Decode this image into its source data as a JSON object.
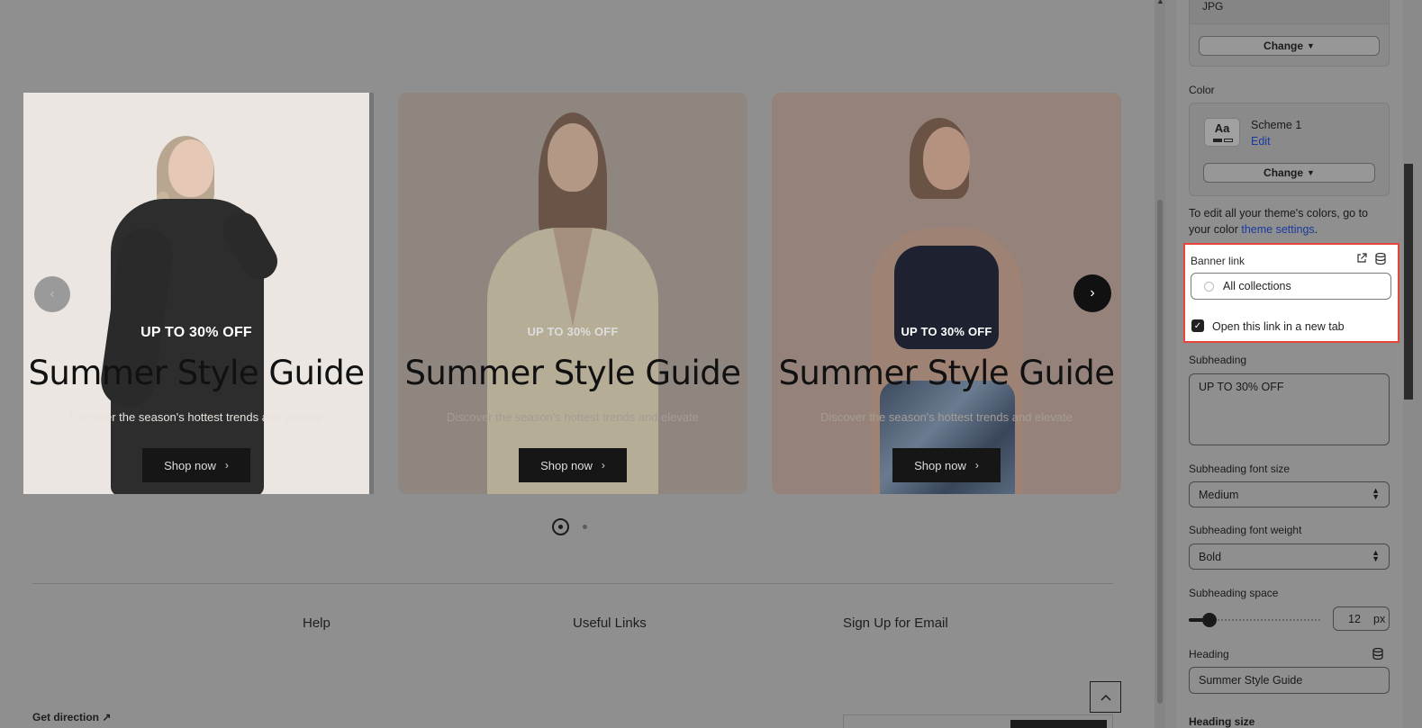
{
  "slides": [
    {
      "subheading": "UP TO 30% OFF",
      "heading": "Summer Style Guide",
      "description": "Discover the season's hottest trends and elevate",
      "button": "Shop now"
    },
    {
      "subheading": "UP TO 30% OFF",
      "heading": "Summer Style Guide",
      "description": "Discover the season's hottest trends and elevate",
      "button": "Shop now"
    },
    {
      "subheading": "UP TO 30% OFF",
      "heading": "Summer Style Guide",
      "description": "Discover the season's hottest trends and elevate",
      "button": "Shop now"
    }
  ],
  "carousel": {
    "prev_icon": "‹",
    "next_icon": "›",
    "active_page": 1,
    "page_count": 2
  },
  "footer": {
    "columns": [
      "Help",
      "Useful Links",
      "Sign Up for Email"
    ],
    "get_direction": "Get direction",
    "back_to_top_icon": "chevron-up-icon"
  },
  "panel": {
    "image_format": "JPG",
    "change_label": "Change",
    "color_label": "Color",
    "scheme": {
      "name": "Scheme 1",
      "edit": "Edit",
      "swatch_text": "Aa"
    },
    "theme_note_prefix": "To edit all your theme's colors, go to your color",
    "theme_note_link": "theme settings",
    "theme_note_suffix": ".",
    "banner_link": {
      "label": "Banner link",
      "value": "All collections",
      "new_tab_label": "Open this link in a new tab",
      "new_tab_checked": true
    },
    "subheading": {
      "label": "Subheading",
      "value": "UP TO 30% OFF"
    },
    "subheading_font_size": {
      "label": "Subheading font size",
      "value": "Medium"
    },
    "subheading_font_weight": {
      "label": "Subheading font weight",
      "value": "Bold"
    },
    "subheading_space": {
      "label": "Subheading space",
      "value": "12",
      "unit": "px"
    },
    "heading": {
      "label": "Heading",
      "value": "Summer Style Guide"
    },
    "heading_size": {
      "label": "Heading size"
    }
  },
  "colors": {
    "highlight_border": "#e7453b",
    "link": "#1a3a9e"
  }
}
